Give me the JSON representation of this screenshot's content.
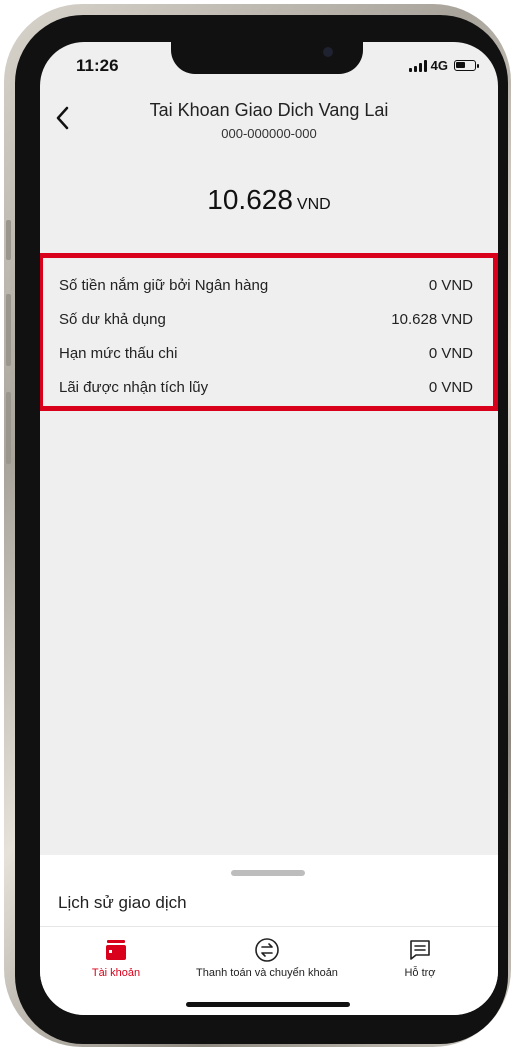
{
  "status_bar": {
    "time": "11:26",
    "network": "4G",
    "battery_level": 0.5
  },
  "header": {
    "back_icon": "chevron-left-icon",
    "title": "Tai Khoan Giao Dich Vang Lai",
    "account_number": "000-000000-000"
  },
  "balance": {
    "amount": "10.628",
    "currency": "VND"
  },
  "details": {
    "highlight_color": "#d9001b",
    "rows": [
      {
        "label": "Số tiền nắm giữ bởi Ngân hàng",
        "value": "0 VND"
      },
      {
        "label": "Số dư khả dụng",
        "value": "10.628 VND"
      },
      {
        "label": "Hạn mức thấu chi",
        "value": "0 VND"
      },
      {
        "label": "Lãi được nhận tích lũy",
        "value": "0 VND"
      }
    ]
  },
  "sheet": {
    "title": "Lịch sử giao dịch"
  },
  "tabbar": {
    "accent_color": "#d9001b",
    "tabs": [
      {
        "label": "Tài khoản",
        "icon": "wallet-icon",
        "active": true
      },
      {
        "label": "Thanh toán và chuyển khoản",
        "icon": "transfer-icon",
        "active": false
      },
      {
        "label": "Hỗ trợ",
        "icon": "chat-icon",
        "active": false
      }
    ]
  }
}
